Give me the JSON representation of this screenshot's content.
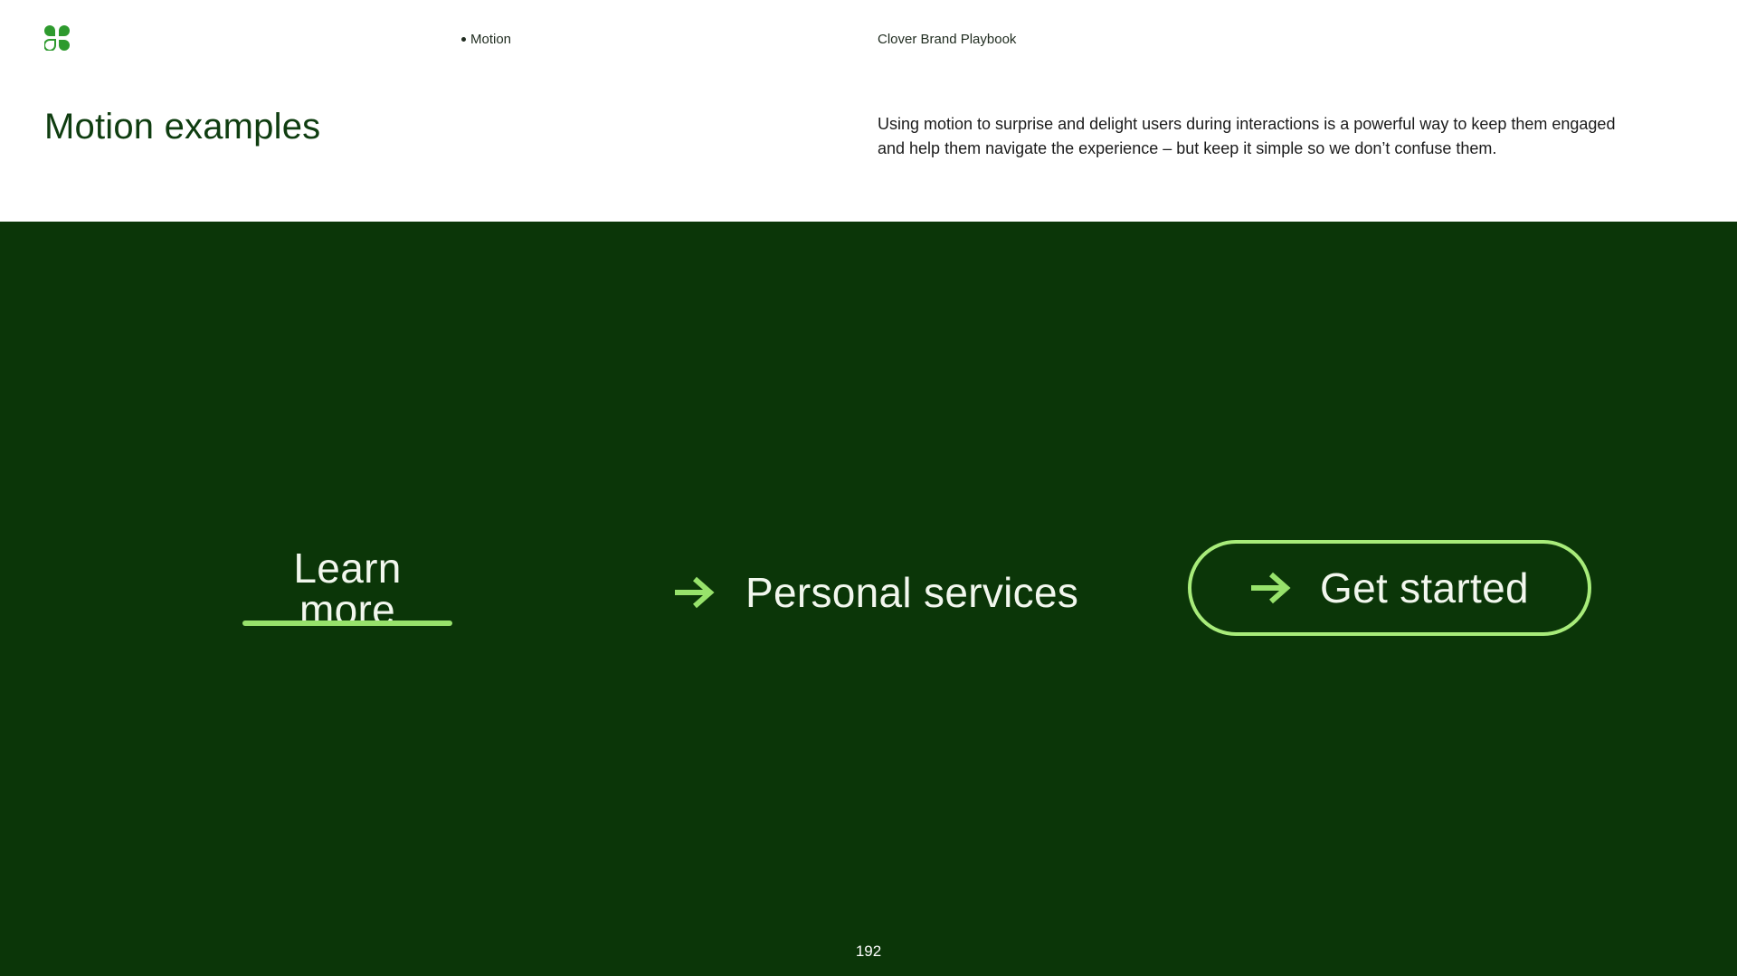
{
  "header": {
    "logo_icon": "clover-logo-icon",
    "breadcrumb": "Motion",
    "doc_title": "Clover Brand Playbook",
    "page_title": "Motion examples",
    "description": "Using motion to surprise and delight users during interactions is a powerful way to keep them engaged and help them navigate the experience – but keep it simple so we don’t confuse them."
  },
  "examples": {
    "learn_more": "Learn more",
    "personal_services": "Personal services",
    "get_started": "Get started",
    "arrow_icon": "arrow-right-icon"
  },
  "footer": {
    "page_number": "192"
  },
  "colors": {
    "background_dark": "#0b3608",
    "accent": "#97e26b",
    "logo_green": "#2e9a2e",
    "title_green": "#0f3d10"
  }
}
